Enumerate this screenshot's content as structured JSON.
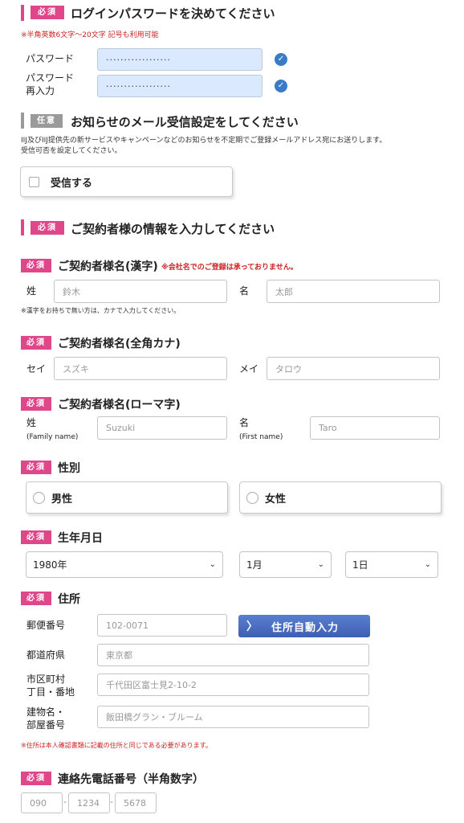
{
  "badges": {
    "required": "必須",
    "optional": "任意"
  },
  "password_section": {
    "title": "ログインパスワードを決めてください",
    "note": "※半角英数6文字〜20文字 記号も利用可能",
    "password_label": "パスワード",
    "password_value": "··················",
    "confirm_label_1": "パスワード",
    "confirm_label_2": "再入力",
    "confirm_value": "··················"
  },
  "newsletter_section": {
    "title": "お知らせのメール受信設定をしてください",
    "desc_1": "IIJ及びIIJ提供先の新サービスやキャンペーンなどのお知らせを不定期でご登録メールアドレス宛にお送りします。",
    "desc_2": "受信可否を設定してください。",
    "checkbox_label": "受信する"
  },
  "contract_section": {
    "title": "ご契約者様の情報を入力してください"
  },
  "name_kanji": {
    "title": "ご契約者様名(漢字)",
    "warning": "※会社名でのご登録は承っておりません。",
    "last_label": "姓",
    "last_placeholder": "鈴木",
    "first_label": "名",
    "first_placeholder": "太郎",
    "note": "※漢字をお持ちで無い方は、カナで入力してください。"
  },
  "name_kana": {
    "title": "ご契約者様名(全角カナ)",
    "last_label": "セイ",
    "last_placeholder": "スズキ",
    "first_label": "メイ",
    "first_placeholder": "タロウ"
  },
  "name_roman": {
    "title": "ご契約者様名(ローマ字)",
    "last_label": "姓",
    "last_sub": "(Family name)",
    "last_placeholder": "Suzuki",
    "first_label": "名",
    "first_sub": "(First name)",
    "first_placeholder": "Taro"
  },
  "gender": {
    "title": "性別",
    "male": "男性",
    "female": "女性"
  },
  "birthdate": {
    "title": "生年月日",
    "year": "1980年",
    "month": "1月",
    "day": "1日"
  },
  "address": {
    "title": "住所",
    "zip_label": "郵便番号",
    "zip_placeholder": "102-0071",
    "auto_button": "住所自動入力",
    "pref_label": "都道府県",
    "pref_placeholder": "東京都",
    "city_label_1": "市区町村",
    "city_label_2": "丁目・番地",
    "city_placeholder": "千代田区富士見2-10-2",
    "bldg_label_1": "建物名・",
    "bldg_label_2": "部屋番号",
    "bldg_placeholder": "飯田橋グラン・ブルーム",
    "note": "※住所は本人確認書類に記載の住所と同じである必要があります。"
  },
  "phone": {
    "title": "連絡先電話番号（半角数字）",
    "part1": "090",
    "part2": "1234",
    "part3": "5678",
    "separator": "-"
  }
}
